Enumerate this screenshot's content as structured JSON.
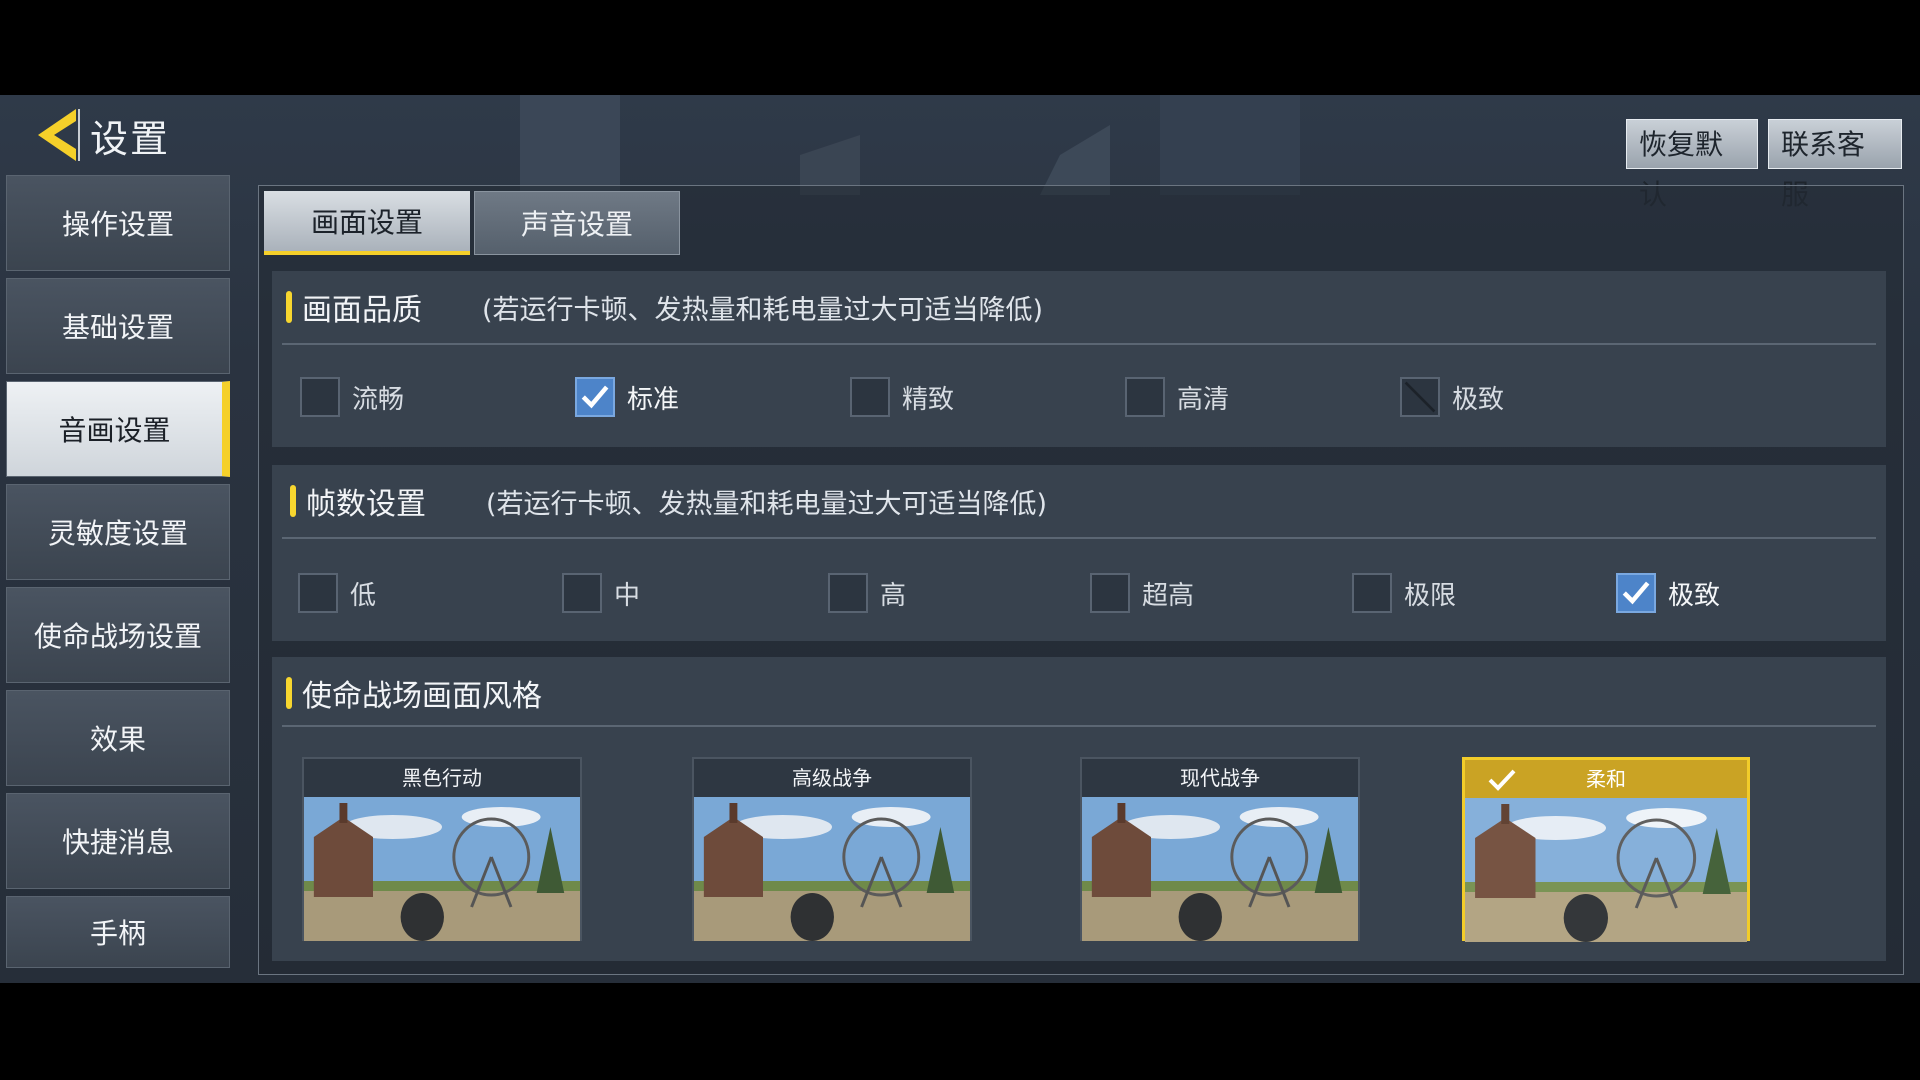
{
  "header": {
    "title": "设置",
    "restore_label": "恢复默认",
    "contact_label": "联系客服"
  },
  "sidebar": {
    "items": [
      {
        "label": "操作设置"
      },
      {
        "label": "基础设置"
      },
      {
        "label": "音画设置"
      },
      {
        "label": "灵敏度设置"
      },
      {
        "label": "使命战场设置"
      },
      {
        "label": "效果"
      },
      {
        "label": "快捷消息"
      },
      {
        "label": "手柄"
      }
    ],
    "active_index": 2
  },
  "tabs": [
    {
      "label": "画面设置"
    },
    {
      "label": "声音设置"
    }
  ],
  "quality": {
    "title": "画面品质",
    "note": "(若运行卡顿、发热量和耗电量过大可适当降低)",
    "options": [
      {
        "label": "流畅",
        "state": "unchecked"
      },
      {
        "label": "标准",
        "state": "checked"
      },
      {
        "label": "精致",
        "state": "unchecked"
      },
      {
        "label": "高清",
        "state": "unchecked"
      },
      {
        "label": "极致",
        "state": "disabled"
      }
    ]
  },
  "frames": {
    "title": "帧数设置",
    "note": "(若运行卡顿、发热量和耗电量过大可适当降低)",
    "options": [
      {
        "label": "低",
        "state": "unchecked"
      },
      {
        "label": "中",
        "state": "unchecked"
      },
      {
        "label": "高",
        "state": "unchecked"
      },
      {
        "label": "超高",
        "state": "unchecked"
      },
      {
        "label": "极限",
        "state": "unchecked"
      },
      {
        "label": "极致",
        "state": "checked"
      }
    ]
  },
  "style": {
    "title": "使命战场画面风格",
    "cards": [
      {
        "label": "黑色行动"
      },
      {
        "label": "高级战争"
      },
      {
        "label": "现代战争"
      },
      {
        "label": "柔和",
        "selected": true
      }
    ]
  },
  "colors": {
    "accent": "#f5d02a",
    "checkbox_checked": "#4d84c9"
  }
}
